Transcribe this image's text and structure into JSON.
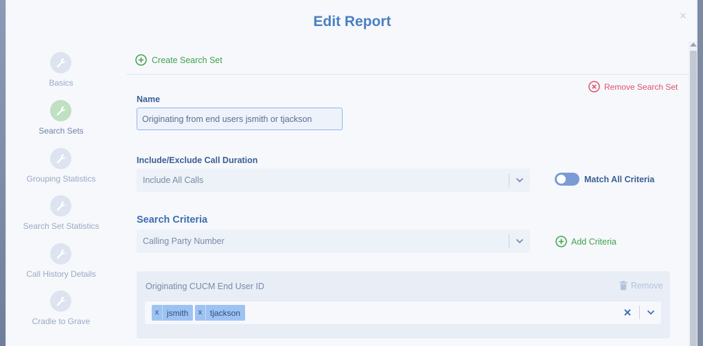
{
  "modal": {
    "title": "Edit Report",
    "close_symbol": "×"
  },
  "steps": [
    {
      "label": "Basics",
      "icon": "wrench-icon",
      "active": false
    },
    {
      "label": "Search Sets",
      "icon": "wrench-icon",
      "active": true
    },
    {
      "label": "Grouping Statistics",
      "icon": "wrench-icon",
      "active": false
    },
    {
      "label": "Search Set Statistics",
      "icon": "wrench-icon",
      "active": false
    },
    {
      "label": "Call History Details",
      "icon": "wrench-icon",
      "active": false
    },
    {
      "label": "Cradle to Grave",
      "icon": "wrench-icon",
      "active": false
    }
  ],
  "toolbar": {
    "create_search_set": "Create Search Set",
    "remove_search_set": "Remove Search Set"
  },
  "form": {
    "name_label": "Name",
    "name_value": "Originating from end users jsmith or tjackson",
    "duration_label": "Include/Exclude Call Duration",
    "duration_value": "Include All Calls",
    "match_all_label": "Match All Criteria",
    "match_all_on": true
  },
  "criteria": {
    "section_title": "Search Criteria",
    "selected_criteria": "Calling Party Number",
    "add_label": "Add Criteria",
    "item": {
      "title": "Originating CUCM End User ID",
      "remove_label": "Remove",
      "tags": [
        "jsmith",
        "tjackson"
      ],
      "tag_remove_symbol": "x"
    }
  },
  "colors": {
    "accent": "#4a7fc1",
    "success": "#3fa24d",
    "danger": "#e0526a",
    "tag": "#9ec3f3"
  }
}
